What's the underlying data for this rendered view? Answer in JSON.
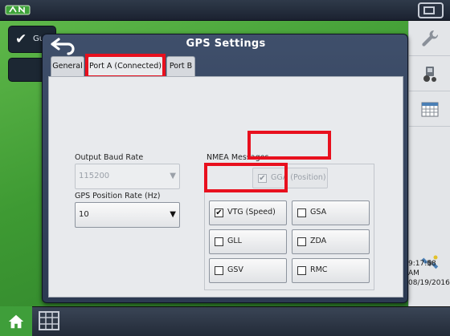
{
  "background": {
    "card_label": "Gu",
    "time": "9:17:58 AM",
    "date": "08/19/2016",
    "icons": [
      "antenna-icon",
      "wrench-icon",
      "tractor-icon",
      "calendar-icon",
      "satellite-icon",
      "home-icon",
      "grid-icon"
    ]
  },
  "dialog": {
    "title": "GPS Settings",
    "tabs": [
      {
        "label": "General"
      },
      {
        "label": "Port A (Connected)"
      },
      {
        "label": "Port B"
      }
    ],
    "output_baud_rate": {
      "label": "Output Baud Rate",
      "value": "115200",
      "enabled": false
    },
    "gps_position_rate": {
      "label": "GPS Position Rate (Hz)",
      "value": "10",
      "enabled": true
    },
    "nmea": {
      "label": "NMEA Messages",
      "messages": [
        {
          "label": "GGA (Position)",
          "checked": true,
          "enabled": false
        },
        {
          "label": "VTG (Speed)",
          "checked": true,
          "enabled": true
        },
        {
          "label": "GSA",
          "checked": false,
          "enabled": true
        },
        {
          "label": "GLL",
          "checked": false,
          "enabled": true
        },
        {
          "label": "ZDA",
          "checked": false,
          "enabled": true
        },
        {
          "label": "GSV",
          "checked": false,
          "enabled": true
        },
        {
          "label": "RMC",
          "checked": false,
          "enabled": true
        }
      ]
    }
  },
  "colors": {
    "highlight": "#e8101e",
    "dialog": "#3a4a66",
    "accent_green": "#3f9e3a"
  }
}
